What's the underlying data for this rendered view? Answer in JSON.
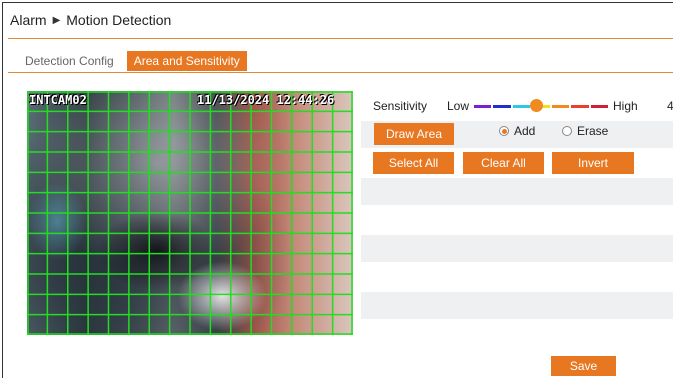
{
  "breadcrumb": {
    "root": "Alarm",
    "separator": "▶",
    "current": "Motion Detection"
  },
  "tabs": [
    {
      "label": "Detection Config",
      "active": false
    },
    {
      "label": "Area and Sensitivity",
      "active": true
    }
  ],
  "video": {
    "camera_name": "INTCAM02",
    "timestamp": "11/13/2024 12:44:26",
    "grid": {
      "columns": 16,
      "rows": 12,
      "line_color": "#22dd22"
    }
  },
  "sensitivity": {
    "label": "Sensitivity",
    "low_label": "Low",
    "high_label": "High",
    "value_partial": "4",
    "level": 0.42,
    "colors": [
      "#7a1fd1",
      "#1f2fd1",
      "#2fc6e8",
      "#f0e11f",
      "#f08b1f",
      "#e8402a",
      "#d11f3a"
    ]
  },
  "buttons": {
    "draw_area": "Draw Area",
    "select_all": "Select All",
    "clear_all": "Clear All",
    "invert": "Invert",
    "save": "Save"
  },
  "mode": {
    "add_label": "Add",
    "erase_label": "Erase",
    "selected": "add"
  },
  "colors": {
    "accent": "#e87722",
    "grid": "#22dd22"
  }
}
